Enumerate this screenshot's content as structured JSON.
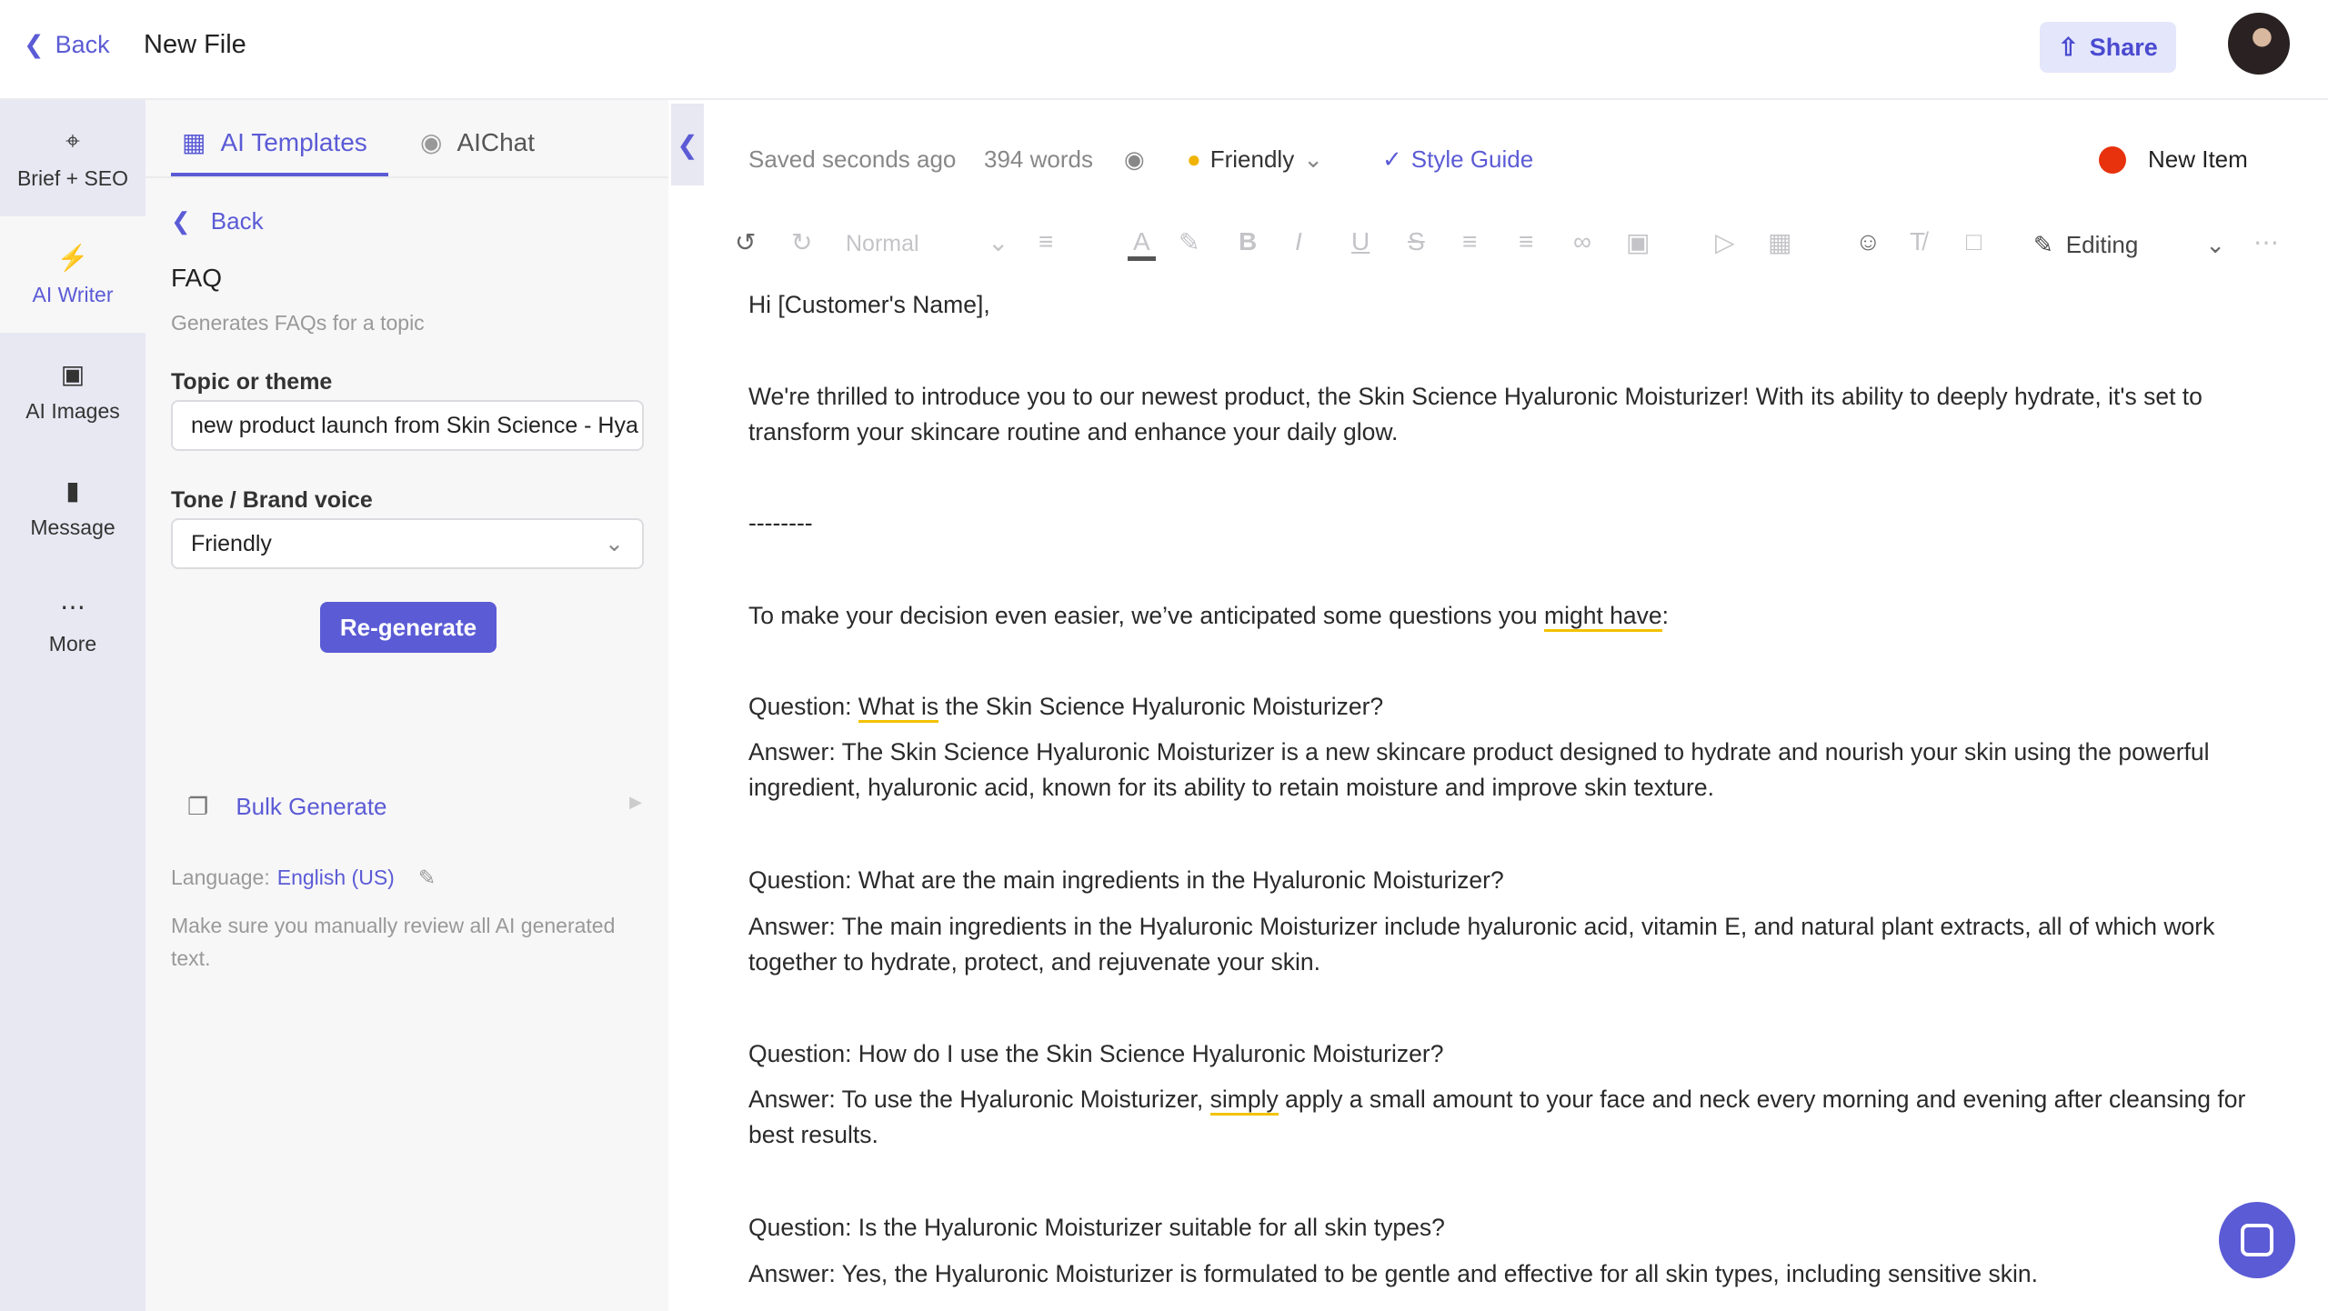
{
  "header": {
    "back_label": "Back",
    "title": "New File",
    "share_label": "Share"
  },
  "rail": {
    "items": [
      {
        "label": "Brief + SEO",
        "icon": "crosshair-icon"
      },
      {
        "label": "AI Writer",
        "icon": "lightning-icon"
      },
      {
        "label": "AI Images",
        "icon": "image-icon"
      },
      {
        "label": "Message",
        "icon": "message-icon"
      },
      {
        "label": "More",
        "icon": "more-icon"
      }
    ]
  },
  "panel": {
    "tabs": [
      {
        "label": "AI Templates"
      },
      {
        "label": "AIChat"
      }
    ],
    "back_label": "Back",
    "template_title": "FAQ",
    "template_desc": "Generates FAQs for a topic",
    "topic_label": "Topic or theme",
    "topic_value": "new product launch from Skin Science - Hya",
    "tone_label": "Tone / Brand voice",
    "tone_value": "Friendly",
    "regenerate_label": "Re-generate",
    "bulk_label": "Bulk Generate",
    "language_label": "Language:",
    "language_value": "English (US)",
    "disclaimer": "Make sure you manually review all AI generated text."
  },
  "status": {
    "saved": "Saved seconds ago",
    "words": "394 words",
    "tone": "Friendly",
    "style_guide": "Style Guide",
    "new_item": "New Item",
    "new_item_color": "#e8320e"
  },
  "toolbar": {
    "style": "Normal",
    "mode": "Editing"
  },
  "doc": {
    "greeting": "Hi [Customer's Name],",
    "intro": "We're thrilled to introduce you to our newest product, the Skin Science Hyaluronic Moisturizer! With its ability to deeply hydrate, it's set to transform your skincare routine and enhance your daily glow.",
    "divider": "--------",
    "lead": {
      "pre": "To make your decision even easier, we’ve anticipated some questions you ",
      "ul": "might have",
      "post": ":"
    },
    "faqs": [
      {
        "q_pre": "Question: ",
        "q_ul": "What is",
        "q_post": " the Skin Science Hyaluronic Moisturizer?",
        "a_pre": "Answer: The Skin Science Hyaluronic Moisturizer is a new skincare product designed to hydrate and nourish your skin using the powerful ingredient, hyaluronic acid, known for its ability to retain moisture and improve skin texture.",
        "a_ul": "",
        "a_post": ""
      },
      {
        "q_pre": "Question: What are the main ingredients in the Hyaluronic Moisturizer?",
        "q_ul": "",
        "q_post": "",
        "a_pre": "Answer: The main ingredients in the Hyaluronic Moisturizer include hyaluronic acid, vitamin E, and natural plant extracts, all of which work together to hydrate, protect, and rejuvenate your skin.",
        "a_ul": "",
        "a_post": ""
      },
      {
        "q_pre": "Question: How do I use the Skin Science Hyaluronic Moisturizer?",
        "q_ul": "",
        "q_post": "",
        "a_pre": "Answer: To use the Hyaluronic Moisturizer, ",
        "a_ul": "simply",
        "a_post": " apply a small amount to your face and neck every morning and evening after cleansing for best results."
      },
      {
        "q_pre": "Question: Is the Hyaluronic Moisturizer suitable for all skin types?",
        "q_ul": "",
        "q_post": "",
        "a_pre": "Answer: Yes, the Hyaluronic Moisturizer is formulated to be gentle and effective for all skin types, including sensitive skin.",
        "a_ul": "",
        "a_post": ""
      }
    ]
  }
}
